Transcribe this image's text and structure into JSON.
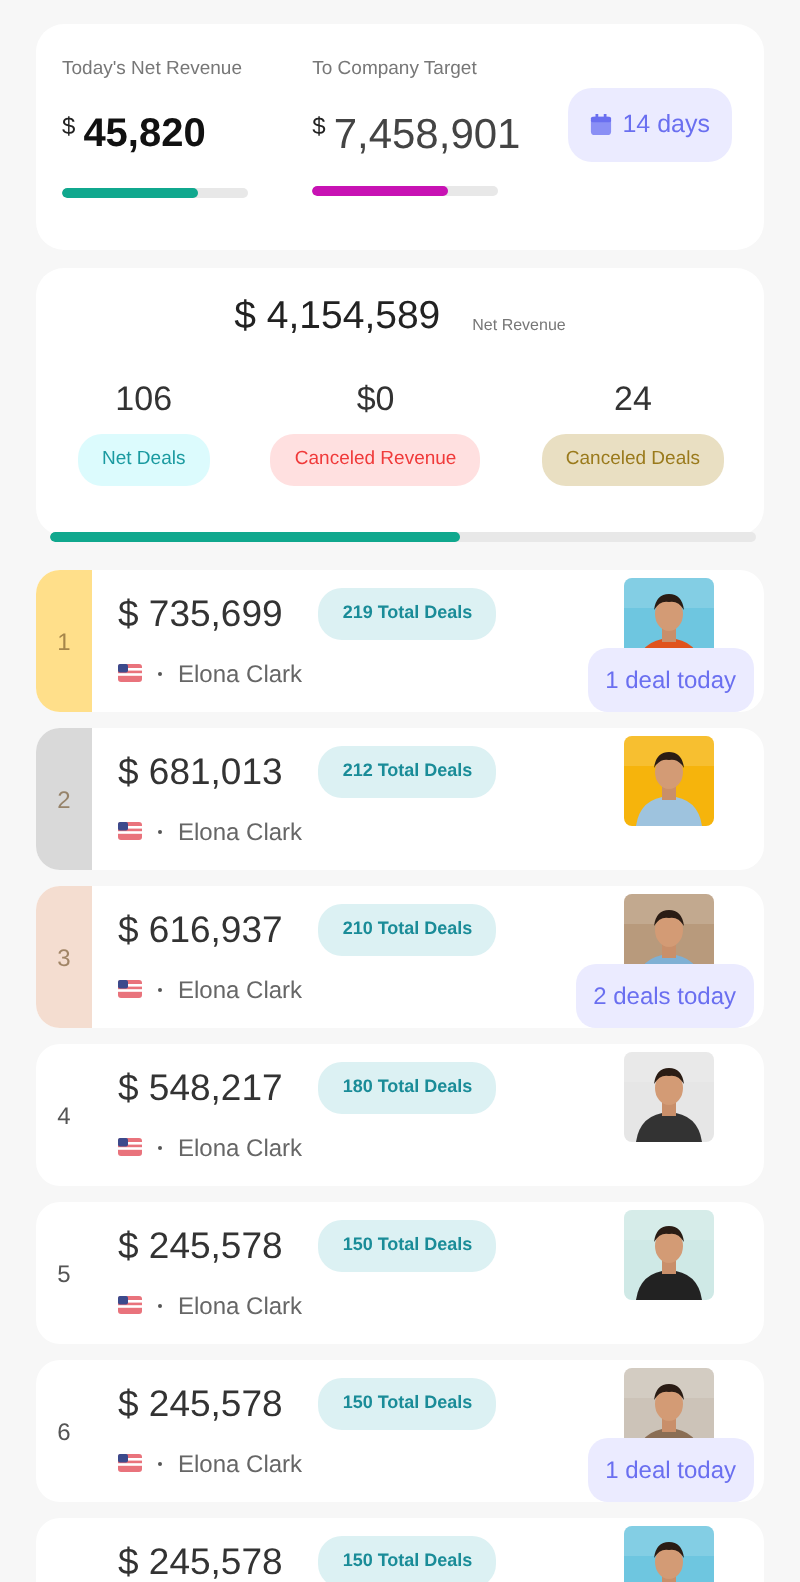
{
  "summary": {
    "today": {
      "label": "Today's Net Revenue",
      "currency": "$",
      "value": "45,820",
      "level": 0.73
    },
    "target": {
      "label": "To Company Target",
      "currency": "$",
      "value": "7,458,901",
      "level": 0.73
    },
    "period_button": "14 days"
  },
  "revenue": {
    "value": "$ 4,154,589",
    "label": "Net Revenue",
    "stats": [
      {
        "value": "106",
        "label": "Net Deals",
        "kind": "cyan"
      },
      {
        "value": "$0",
        "label": "Canceled Revenue",
        "kind": "red"
      },
      {
        "value": "24",
        "label": "Canceled Deals",
        "kind": "tan"
      }
    ],
    "level": 0.58
  },
  "leaders": [
    {
      "rank": "1",
      "color": "#ffdf8a",
      "amount": "$ 735,699",
      "deals": "219 Total Deals",
      "name": "Elona Clark",
      "today": "1 deal today"
    },
    {
      "rank": "2",
      "color": "#d9d9d9",
      "amount": "$ 681,013",
      "deals": "212 Total Deals",
      "name": "Elona Clark"
    },
    {
      "rank": "3",
      "color": "#f4ddd0",
      "amount": "$ 616,937",
      "deals": "210 Total Deals",
      "name": "Elona Clark",
      "today": "2 deals today"
    },
    {
      "rank": "4",
      "amount": "$ 548,217",
      "deals": "180 Total Deals",
      "name": "Elona Clark"
    },
    {
      "rank": "5",
      "amount": "$ 245,578",
      "deals": "150 Total Deals",
      "name": "Elona Clark"
    },
    {
      "rank": "6",
      "amount": "$ 245,578",
      "deals": "150 Total Deals",
      "name": "Elona Clark",
      "today": "1 deal today"
    },
    {
      "amount": "$ 245,578",
      "deals": "150 Total Deals"
    }
  ]
}
